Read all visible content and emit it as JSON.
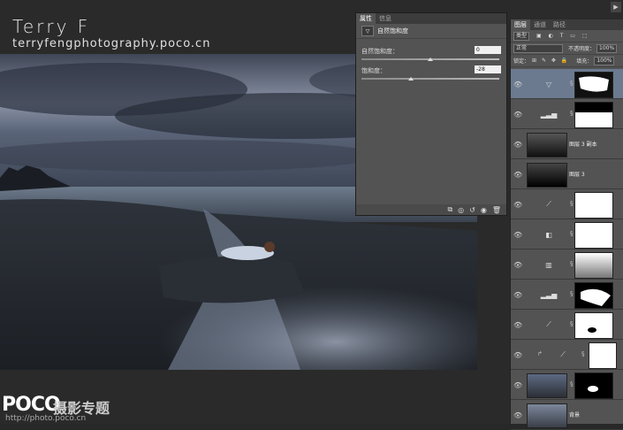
{
  "watermark": {
    "name": "Terry F",
    "url": "terryfengphotography.poco.cn"
  },
  "brand": {
    "logo": "POCO",
    "subtitle": "摄影专题",
    "site": "http://photo.poco.cn"
  },
  "properties_panel": {
    "tabs": [
      "属性",
      "信息"
    ],
    "active_tab": 0,
    "title": "自然饱和度",
    "vibrance_label": "自然饱和度：",
    "vibrance_value": "0",
    "saturation_label": "饱和度：",
    "saturation_value": "-28",
    "vibrance_level": 0,
    "saturation_level": -28
  },
  "layers_panel": {
    "tabs": [
      "图层",
      "通道",
      "路径"
    ],
    "active_tab": 0,
    "kind_filter": "类型",
    "blend_mode": "正常",
    "opacity_label": "不透明度：",
    "opacity_value": "100%",
    "lock_label": "锁定：",
    "fill_label": "填充：",
    "fill_value": "100%",
    "layers": [
      {
        "kind": "vibrance-adjustment",
        "selected": true
      },
      {
        "kind": "levels-adjustment"
      },
      {
        "kind": "pixel",
        "name": "图层 3 副本"
      },
      {
        "kind": "pixel",
        "name": "图层 3"
      },
      {
        "kind": "curves-adjustment"
      },
      {
        "kind": "brightness-adjustment"
      },
      {
        "kind": "channel-mixer-adjustment"
      },
      {
        "kind": "levels-adjustment"
      },
      {
        "kind": "curves-adjustment"
      },
      {
        "kind": "curves-adjustment-grouped"
      },
      {
        "kind": "pixel-with-mask"
      },
      {
        "kind": "pixel",
        "name": "背景"
      }
    ]
  },
  "colors": {
    "panel_bg": "#535353",
    "workspace_bg": "#282828",
    "selected_layer": "#6b7a8f"
  }
}
